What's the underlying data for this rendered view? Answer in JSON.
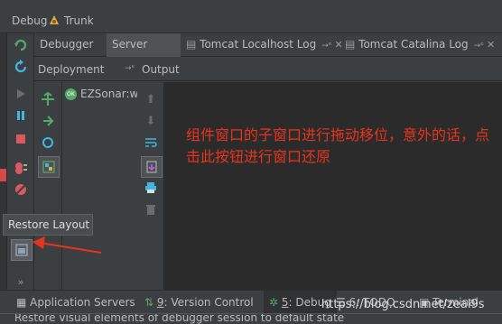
{
  "window": {
    "title": "Debug",
    "run_config": "Trunk"
  },
  "tabs": [
    {
      "label": "Debugger",
      "active": false
    },
    {
      "label": "Server",
      "active": true
    },
    {
      "label": "Tomcat Localhost Log",
      "active": false
    },
    {
      "label": "Tomcat Catalina Log",
      "active": false
    }
  ],
  "subheader": {
    "deployment": "Deployment",
    "output": "Output"
  },
  "deployment": {
    "items": [
      {
        "label": "EZSonar:wa"
      }
    ]
  },
  "tooltip": {
    "text": "Restore Layout"
  },
  "annotation": {
    "text": "组件窗口的子窗口进行拖动移位，意外的话，点击此按钮进行窗口还原"
  },
  "bottom_tabs": [
    {
      "label": "Application Servers"
    },
    {
      "number": "9",
      "label": ": Version Control"
    },
    {
      "number": "5",
      "label": ": Debug",
      "active": true
    },
    {
      "number": "6",
      "label": ": TODO"
    },
    {
      "label": "Terminal"
    }
  ],
  "status": {
    "text": "Restore visual elements of debugger session to default state"
  },
  "watermark": {
    "text": "https://blog.csdn.net/zeal9s"
  },
  "colors": {
    "annotation": "#e8341c",
    "accent_green": "#59a869",
    "accent_blue": "#40b6e0",
    "stop_red": "#db5860"
  }
}
